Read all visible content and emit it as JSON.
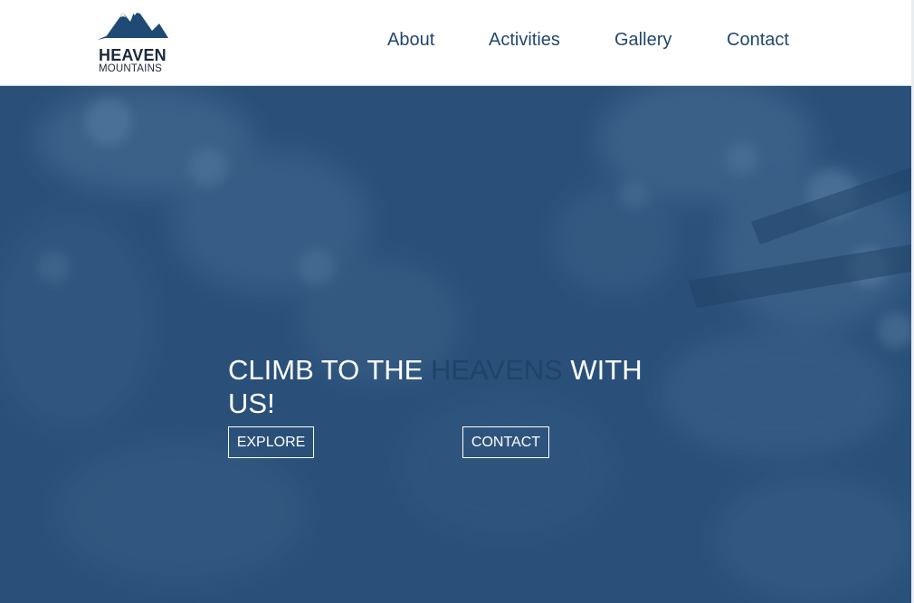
{
  "brand": {
    "name_line1": "HEAVEN",
    "name_line2": "MOUNTAINS",
    "logo_icon": "mountain-icon",
    "color": "#1b2a3a"
  },
  "nav": {
    "items": [
      {
        "label": "About"
      },
      {
        "label": "Activities"
      },
      {
        "label": "Gallery"
      },
      {
        "label": "Contact"
      }
    ],
    "color": "#22486e"
  },
  "hero": {
    "headline_part1": "CLIMB TO THE ",
    "headline_accent": "HEAVENS",
    "headline_part2": " WITH US!",
    "background_color": "#2a5078",
    "accent_color": "#1f4468",
    "buttons": {
      "explore_label": "EXPLORE",
      "contact_label": "CONTACT"
    }
  }
}
